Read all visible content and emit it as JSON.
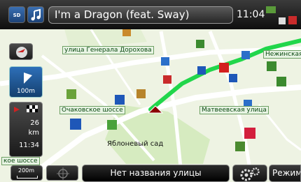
{
  "now_playing": {
    "source_icon_label": "SD",
    "note_icon": "music-note-icon",
    "title": "I'm a Dragon (feat. Sway)"
  },
  "status": {
    "clock": "11:04"
  },
  "map": {
    "streets": [
      {
        "name": "улица Генерала Дорохова"
      },
      {
        "name": "Нежинская"
      },
      {
        "name": "Очаковское шоссе"
      },
      {
        "name": "Матвеевская улица"
      },
      {
        "name": "кое шоссе"
      }
    ],
    "place": "Яблоневый сад",
    "colors": {
      "land": "#eef3e3",
      "route": "#21d64b",
      "road": "#ffffff",
      "park": "#cfe6b3"
    }
  },
  "guidance": {
    "turn_distance": "100m",
    "dest_distance_value": "26",
    "dest_distance_unit": "km",
    "arrival_time": "11:34"
  },
  "bottom": {
    "scale": "200m",
    "street_name": "Нет названия улицы",
    "mode_label": "Режим"
  }
}
